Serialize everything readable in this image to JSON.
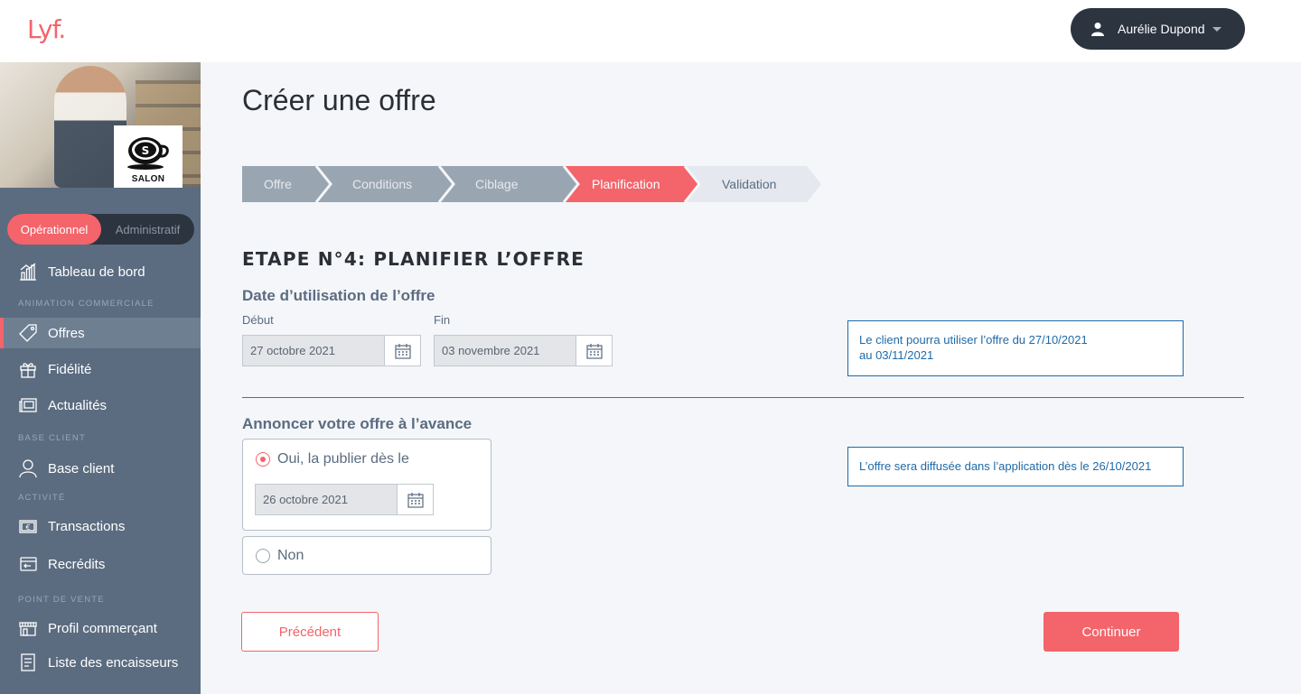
{
  "app": {
    "logo": "Lyf."
  },
  "header": {
    "user_name": "Aurélie Dupond"
  },
  "store": {
    "name": "SALON"
  },
  "sidebar": {
    "mode_active": "Opérationnel",
    "mode_inactive": "Administratif",
    "items": {
      "dashboard": "Tableau de bord",
      "section_animation": "Animation commerciale",
      "offres": "Offres",
      "fidelite": "Fidélité",
      "actualites": "Actualités",
      "section_base": "Base client",
      "base_client": "Base client",
      "section_activite": "Activité",
      "transactions": "Transactions",
      "recredits": "Recrédits",
      "section_pdv": "Point de vente",
      "profil": "Profil commerçant",
      "encaisseurs": "Liste des encaisseurs"
    }
  },
  "main": {
    "title": "Créer une offre",
    "steps": [
      {
        "label": "Offre",
        "state": "done"
      },
      {
        "label": "Conditions",
        "state": "done"
      },
      {
        "label": "Ciblage",
        "state": "done"
      },
      {
        "label": "Planification",
        "state": "active"
      },
      {
        "label": "Validation",
        "state": "todo"
      }
    ],
    "step_title": "ETAPE N°4: PLANIFIER L’OFFRE",
    "usage": {
      "title": "Date d’utilisation de l’offre",
      "start_label": "Début",
      "start_value": "27 octobre 2021",
      "end_label": "Fin",
      "end_value": "03 novembre 2021",
      "info_line1": "Le client pourra utiliser l’offre du 27/10/2021",
      "info_line2": "au 03/11/2021"
    },
    "announce": {
      "title": "Annoncer votre offre à l’avance",
      "yes_label": "Oui, la publier dès le",
      "yes_date": "26 octobre 2021",
      "no_label": "Non",
      "info": "L’offre sera diffusée dans l’application dès le 26/10/2021"
    },
    "buttons": {
      "prev": "Précédent",
      "next": "Continuer"
    }
  },
  "colors": {
    "accent": "#f4646b",
    "sidebar": "#5b6c80",
    "dark": "#2c3440",
    "info_blue": "#1e6aa8"
  }
}
